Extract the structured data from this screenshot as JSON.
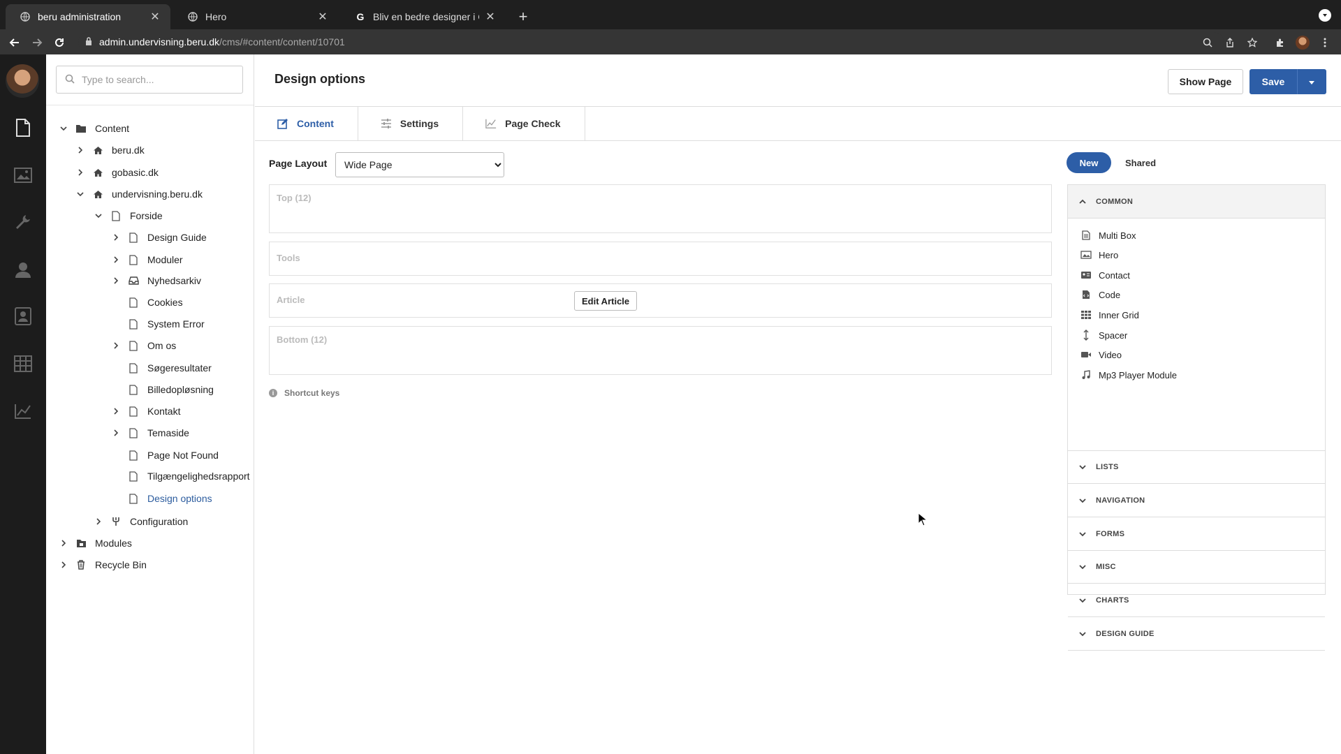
{
  "browser": {
    "tabs": [
      {
        "title": "beru administration",
        "active": true
      },
      {
        "title": "Hero",
        "active": false
      },
      {
        "title": "Bliv en bedre designer i GoBasic",
        "active": false
      }
    ],
    "url_host": "admin.undervisning.beru.dk",
    "url_path": "/cms/#content/content/10701"
  },
  "rail": {
    "items": [
      "content-icon",
      "media-icon",
      "settings-icon",
      "users-icon",
      "members-icon",
      "data-icon",
      "analytics-icon"
    ]
  },
  "tree": {
    "search_placeholder": "Type to search...",
    "items": [
      {
        "label": "Content"
      },
      {
        "label": "beru.dk"
      },
      {
        "label": "gobasic.dk"
      },
      {
        "label": "undervisning.beru.dk"
      },
      {
        "label": "Forside"
      },
      {
        "label": "Design Guide"
      },
      {
        "label": "Moduler"
      },
      {
        "label": "Nyhedsarkiv"
      },
      {
        "label": "Cookies"
      },
      {
        "label": "System Error"
      },
      {
        "label": "Om os"
      },
      {
        "label": "Søgeresultater"
      },
      {
        "label": "Billedopløsning"
      },
      {
        "label": "Kontakt"
      },
      {
        "label": "Temaside"
      },
      {
        "label": "Page Not Found"
      },
      {
        "label": "Tilgængelighedsrapport"
      },
      {
        "label": "Design options"
      },
      {
        "label": "Configuration"
      },
      {
        "label": "Modules"
      },
      {
        "label": "Recycle Bin"
      }
    ]
  },
  "header": {
    "title": "Design options",
    "show_page": "Show Page",
    "save": "Save"
  },
  "tabs": [
    {
      "label": "Content"
    },
    {
      "label": "Settings"
    },
    {
      "label": "Page Check"
    }
  ],
  "layout": {
    "label": "Page Layout",
    "selected": "Wide Page"
  },
  "zones": {
    "top": "Top (12)",
    "tools": "Tools",
    "article": "Article",
    "edit_article": "Edit Article",
    "bottom": "Bottom (12)"
  },
  "shortcut_keys": "Shortcut keys",
  "palette": {
    "toggle_new": "New",
    "toggle_shared": "Shared",
    "common_label": "COMMON",
    "common_items": [
      {
        "label": "Multi Box"
      },
      {
        "label": "Hero"
      },
      {
        "label": "Contact"
      },
      {
        "label": "Code"
      },
      {
        "label": "Inner Grid"
      },
      {
        "label": "Spacer"
      },
      {
        "label": "Video"
      },
      {
        "label": "Mp3 Player Module"
      }
    ],
    "categories": [
      {
        "label": "LISTS"
      },
      {
        "label": "NAVIGATION"
      },
      {
        "label": "FORMS"
      },
      {
        "label": "MISC"
      },
      {
        "label": "CHARTS"
      },
      {
        "label": "DESIGN GUIDE"
      }
    ]
  },
  "colors": {
    "accent": "#2d5ea7",
    "rail": "#1c1c1c",
    "chrome": "#353535"
  }
}
